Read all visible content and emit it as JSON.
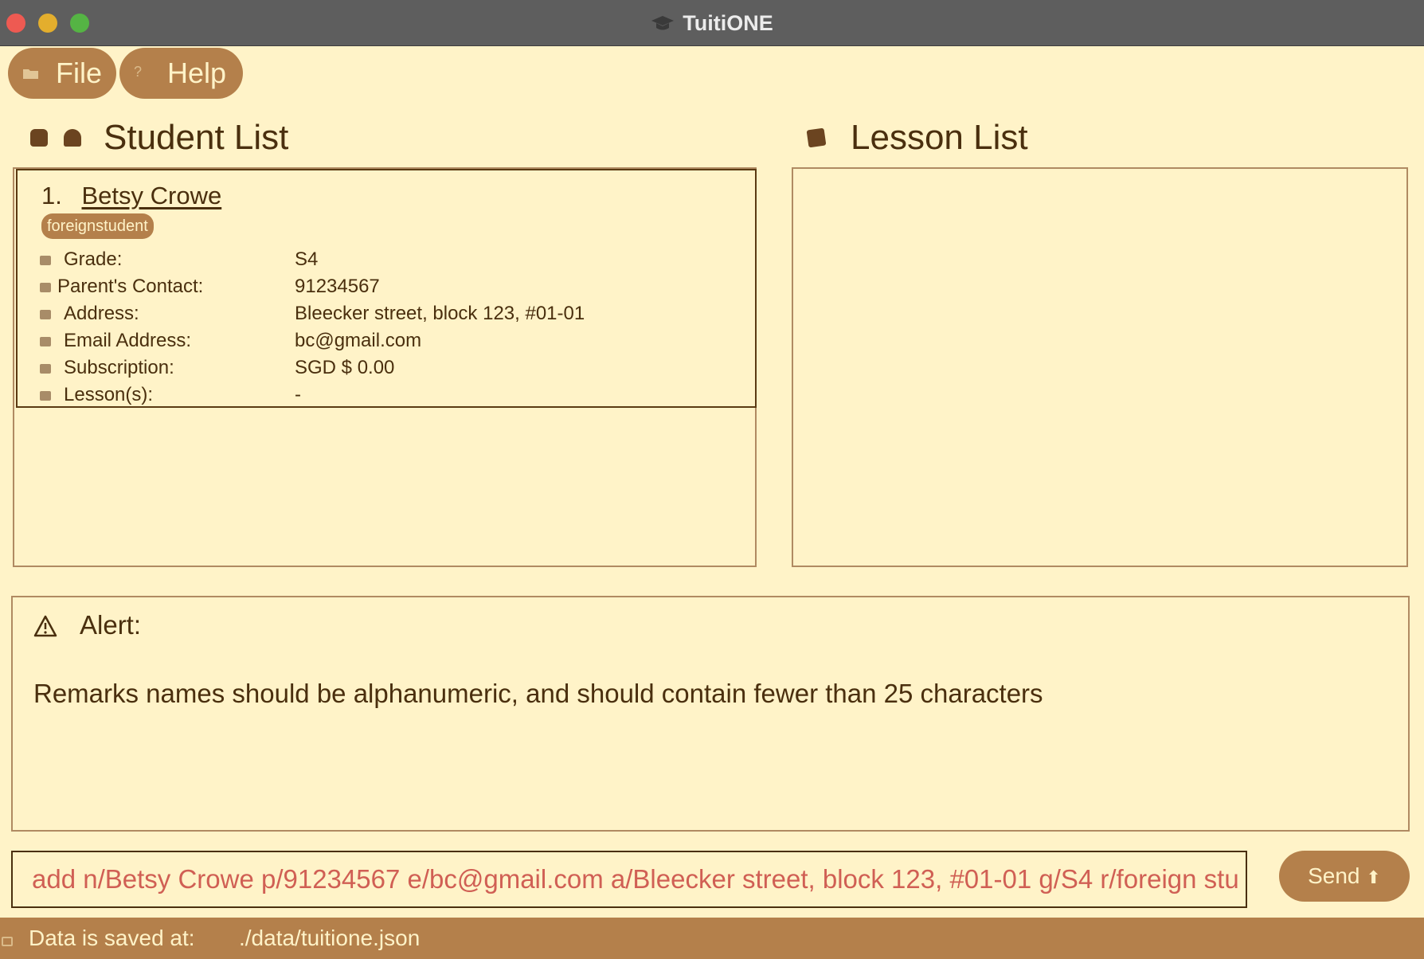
{
  "window": {
    "title": "TuitiONE"
  },
  "menu": {
    "file_label": "File",
    "help_label": "Help"
  },
  "student_list": {
    "heading": "Student List",
    "students": [
      {
        "index": "1.",
        "name": "Betsy Crowe",
        "tags": [
          "foreignstudent"
        ],
        "fields": [
          {
            "label": "Grade:",
            "value": "S4",
            "icon": "grade-icon"
          },
          {
            "label": "Parent's Contact:",
            "value": "91234567",
            "icon": "phone-icon"
          },
          {
            "label": "Address:",
            "value": "Bleecker street, block 123, #01-01",
            "icon": "home-icon"
          },
          {
            "label": "Email Address:",
            "value": "bc@gmail.com",
            "icon": "email-icon"
          },
          {
            "label": "Subscription:",
            "value": "SGD $ 0.00",
            "icon": "money-icon"
          },
          {
            "label": "Lesson(s):",
            "value": "-",
            "icon": "lesson-icon"
          }
        ]
      }
    ]
  },
  "lesson_list": {
    "heading": "Lesson List"
  },
  "alert": {
    "label": "Alert:",
    "message": "Remarks names should be alphanumeric, and should contain fewer than 25 characters"
  },
  "command": {
    "value": "add n/Betsy Crowe p/91234567 e/bc@gmail.com a/Bleecker street, block 123, #01-01 g/S4 r/foreign stu",
    "send_label": "Send"
  },
  "status": {
    "label": "Data is saved at:",
    "path": "./data/tuitione.json"
  },
  "colors": {
    "background": "#fff3c8",
    "accent": "#b4804b",
    "text": "#4a2f0e",
    "command_text": "#d05f54",
    "titlebar": "#5e5e5e"
  }
}
